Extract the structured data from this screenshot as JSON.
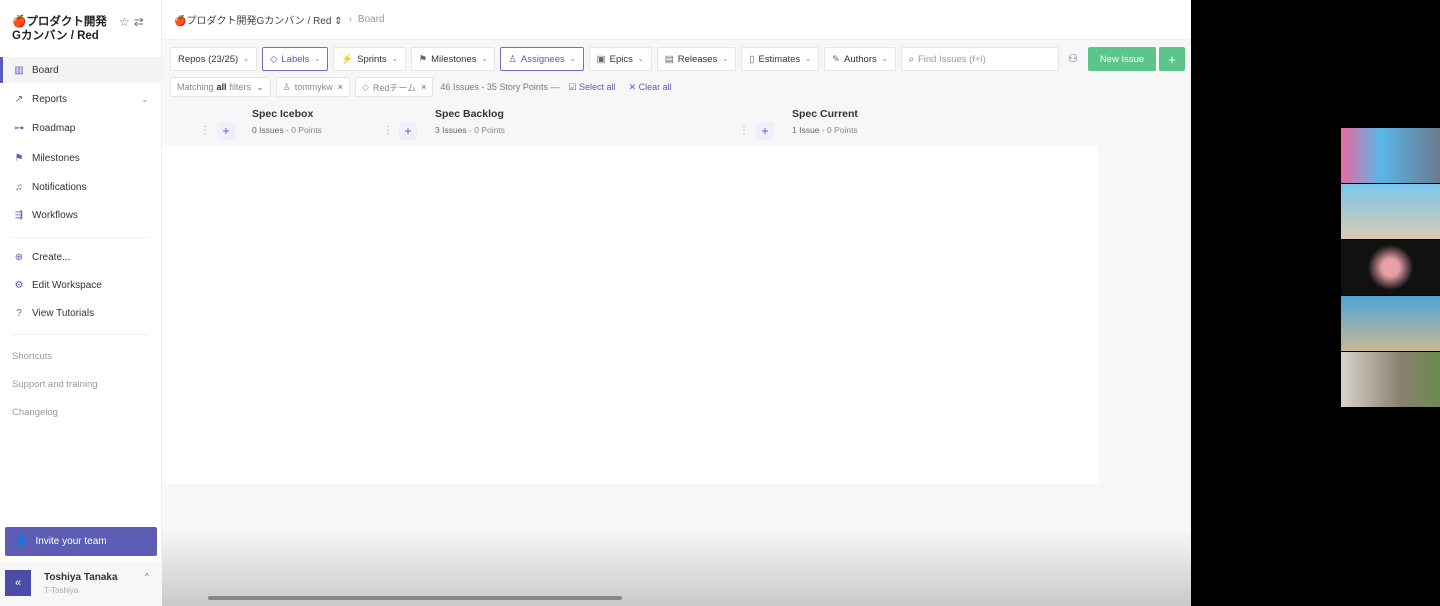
{
  "sidebar": {
    "workspace": "🍎プロダクト開発Gカンバン / Red",
    "items": [
      {
        "label": "Board",
        "icon": "board-icon",
        "glyph": "▥"
      },
      {
        "label": "Reports",
        "icon": "reports-icon",
        "glyph": "↗"
      },
      {
        "label": "Roadmap",
        "icon": "roadmap-icon",
        "glyph": "⊶"
      },
      {
        "label": "Milestones",
        "icon": "milestone-icon",
        "glyph": "⚑"
      },
      {
        "label": "Notifications",
        "icon": "bell-icon",
        "glyph": "🔔"
      },
      {
        "label": "Workflows",
        "icon": "workflow-icon",
        "glyph": "⇶"
      }
    ],
    "actions": [
      {
        "label": "Create...",
        "glyph": "⊕"
      },
      {
        "label": "Edit Workspace",
        "glyph": "⚙"
      },
      {
        "label": "View Tutorials",
        "glyph": "?"
      }
    ],
    "links": [
      "Shortcuts",
      "Support and training",
      "Changelog"
    ],
    "invite": "Invite your team",
    "user": {
      "name": "Toshiya Tanaka",
      "handle": "T-Toshiya"
    }
  },
  "header": {
    "workspace": "🍎プロダクト開発Gカンバン / Red ⇕",
    "page": "Board"
  },
  "toolbar": {
    "filters": [
      {
        "label": "Repos (23/25)",
        "glyph": ""
      },
      {
        "label": "Labels",
        "glyph": "⌂"
      },
      {
        "label": "Sprints",
        "glyph": "⚡"
      },
      {
        "label": "Milestones",
        "glyph": "⚑"
      },
      {
        "label": "Assignees",
        "glyph": "♙"
      },
      {
        "label": "Epics",
        "glyph": "▣"
      },
      {
        "label": "Releases",
        "glyph": "▤"
      },
      {
        "label": "Estimates",
        "glyph": "▯"
      },
      {
        "label": "Authors",
        "glyph": "✎"
      }
    ],
    "search_placeholder": "Find Issues (f+i)",
    "new_issue": "New Issue"
  },
  "filter_bar": {
    "matching_prefix": "Matching",
    "matching_bold": "all",
    "matching_suffix": "filters",
    "chips": [
      "tommykw",
      "Redチーム"
    ],
    "count": "46 Issues - 35 Story Points —",
    "select_all": "Select all",
    "clear_all": "Clear all"
  },
  "columns": [
    {
      "title": "Spec Icebox",
      "issues": "0 Issues",
      "points": "- 0 Points"
    },
    {
      "title": "Spec Backlog",
      "issues": "3 Issues",
      "points": "- 0 Points"
    },
    {
      "title": "Spec Current",
      "issues": "1 Issue",
      "points": "- 0 Points"
    }
  ]
}
